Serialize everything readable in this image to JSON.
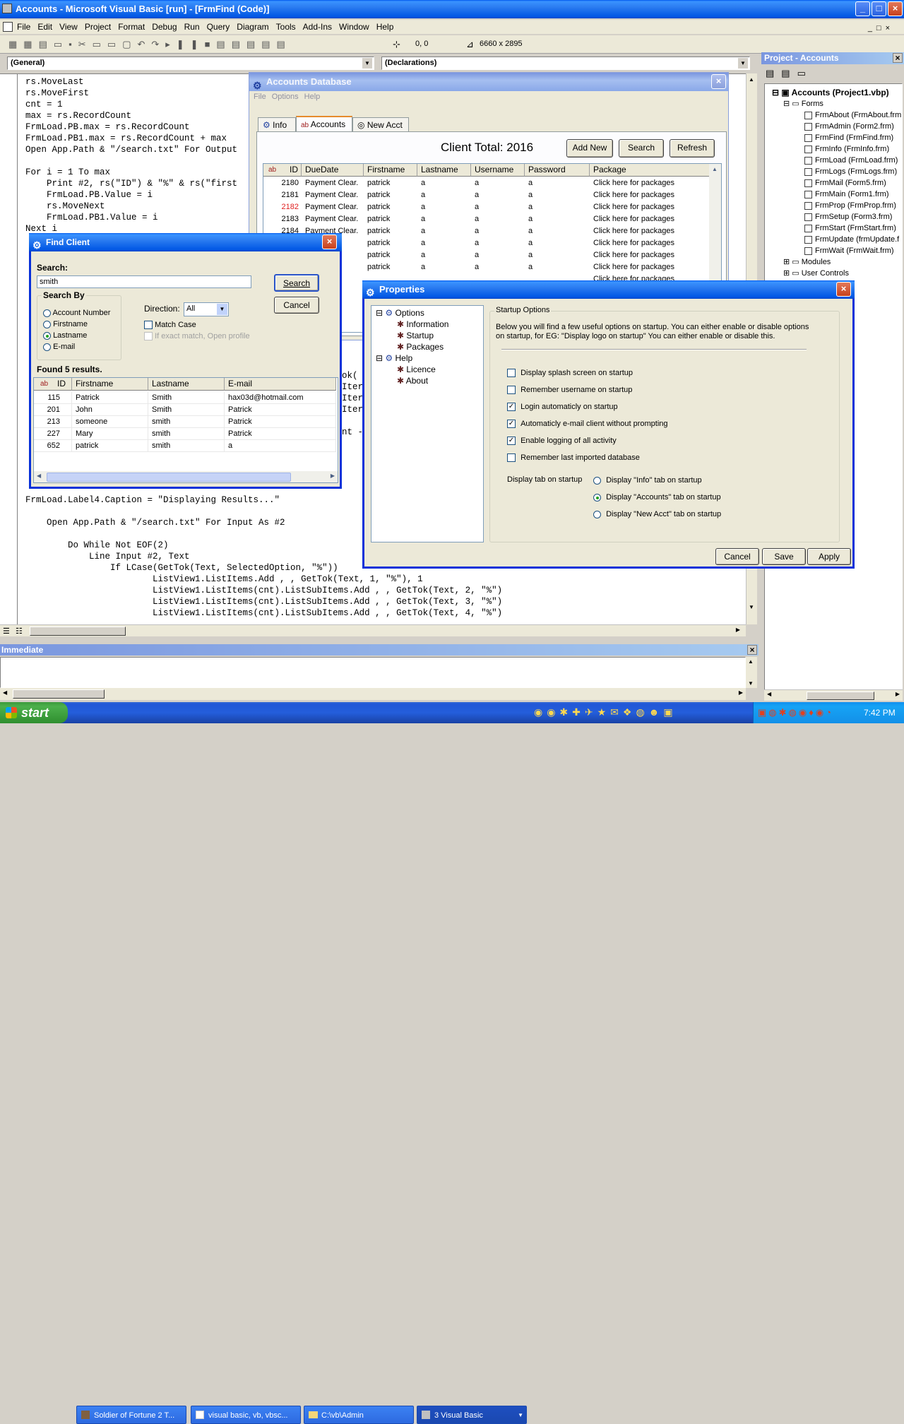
{
  "main_title": "Accounts - Microsoft Visual Basic [run] - [FrmFind (Code)]",
  "menu": [
    "File",
    "Edit",
    "View",
    "Project",
    "Format",
    "Debug",
    "Run",
    "Query",
    "Diagram",
    "Tools",
    "Add-Ins",
    "Window",
    "Help"
  ],
  "toolbar": {
    "coords": "0, 0",
    "size": "6660 x 2895"
  },
  "combo_left": "(General)",
  "combo_right": "(Declarations)",
  "code_lines": [
    "rs.MoveLast",
    "rs.MoveFirst",
    "cnt = 1",
    "max = rs.RecordCount",
    "FrmLoad.PB.max = rs.RecordCount",
    "FrmLoad.PB1.max = rs.RecordCount + max",
    "Open App.Path & \"/search.txt\" For Output",
    "",
    "For i = 1 To max",
    "    Print #2, rs(\"ID\") & \"%\" & rs(\"first",
    "    FrmLoad.PB.Value = i",
    "    rs.MoveNext",
    "    FrmLoad.PB1.Value = i",
    "Next i"
  ],
  "code_lines2": [
    "FrmLoad.Label4.Caption = \"Displaying Results...\"",
    "",
    "    Open App.Path & \"/search.txt\" For Input As #2",
    "",
    "        Do While Not EOF(2)",
    "            Line Input #2, Text",
    "                If LCase(GetTok(Text, SelectedOption, \"%\"))",
    "                        ListView1.ListItems.Add , , GetTok(Text, 1, \"%\"), 1",
    "                        ListView1.ListItems(cnt).ListSubItems.Add , , GetTok(Text, 2, \"%\")",
    "                        ListView1.ListItems(cnt).ListSubItems.Add , , GetTok(Text, 3, \"%\")",
    "                        ListView1.ListItems(cnt).ListSubItems.Add , , GetTok(Text, 4, \"%\")"
  ],
  "code_frag": [
    "ok(",
    "Iter",
    "Iter",
    "Iter",
    "",
    "nt -"
  ],
  "project": {
    "title": "Project - Accounts",
    "root": "Accounts (Project1.vbp)",
    "forms_label": "Forms",
    "forms": [
      "FrmAbout (FrmAbout.frm",
      "FrmAdmin (Form2.frm)",
      "FrmFind (FrmFind.frm)",
      "FrmInfo (FrmInfo.frm)",
      "FrmLoad (FrmLoad.frm)",
      "FrmLogs (FrmLogs.frm)",
      "FrmMail (Form5.frm)",
      "FrmMain (Form1.frm)",
      "FrmProp (FrmProp.frm)",
      "FrmSetup (Form3.frm)",
      "FrmStart (FrmStart.frm)",
      "FrmUpdate (frmUpdate.f",
      "FrmWait (FrmWait.frm)"
    ],
    "others": [
      "Modules",
      "User Controls"
    ]
  },
  "immediate": "Immediate",
  "accounts": {
    "title": "Accounts Database",
    "menu": [
      "File",
      "Options",
      "Help"
    ],
    "tabs": [
      "Info",
      "Accounts",
      "New Acct"
    ],
    "client_total": "Client Total: 2016",
    "buttons": [
      "Add New",
      "Search",
      "Refresh"
    ],
    "columns": [
      "ID",
      "DueDate",
      "Firstname",
      "Lastname",
      "Username",
      "Password",
      "Package"
    ],
    "rows": [
      [
        "2180",
        "Payment Clear.",
        "patrick",
        "a",
        "a",
        "a",
        "Click here for packages"
      ],
      [
        "2181",
        "Payment Clear.",
        "patrick",
        "a",
        "a",
        "a",
        "Click here for packages"
      ],
      [
        "2182",
        "Payment Clear.",
        "patrick",
        "a",
        "a",
        "a",
        "Click here for packages"
      ],
      [
        "2183",
        "Payment Clear.",
        "patrick",
        "a",
        "a",
        "a",
        "Click here for packages"
      ],
      [
        "2184",
        "Payment Clear.",
        "patrick",
        "a",
        "a",
        "a",
        "Click here for packages"
      ],
      [
        "",
        "lear.",
        "patrick",
        "a",
        "a",
        "a",
        "Click here for packages"
      ],
      [
        "",
        "lear.",
        "patrick",
        "a",
        "a",
        "a",
        "Click here for packages"
      ],
      [
        "",
        "lear.",
        "patrick",
        "a",
        "a",
        "a",
        "Click here for packages"
      ],
      [
        "",
        "lear.",
        "",
        "",
        "",
        "",
        "Click here for packages"
      ]
    ],
    "frag_rows": [
      "lear.",
      "lear.",
      "lear."
    ]
  },
  "find": {
    "title": "Find Client",
    "search_label": "Search:",
    "search_value": "smith",
    "search_btn": "Search",
    "cancel_btn": "Cancel",
    "group": "Search By",
    "options": [
      "Account Number",
      "Firstname",
      "Lastname",
      "E-mail"
    ],
    "direction_label": "Direction:",
    "direction_value": "All",
    "match_case": "Match Case",
    "exact": "If exact match, Open profile",
    "found": "Found 5 results.",
    "columns": [
      "ID",
      "Firstname",
      "Lastname",
      "E-mail"
    ],
    "rows": [
      [
        "115",
        "Patrick",
        "Smith",
        "hax03d@hotmail.com"
      ],
      [
        "201",
        "John",
        "Smith",
        "Patrick"
      ],
      [
        "213",
        "someone",
        "smith",
        "Patrick"
      ],
      [
        "227",
        "Mary",
        "smith",
        "Patrick"
      ],
      [
        "652",
        "patrick",
        "smith",
        "a"
      ]
    ]
  },
  "props": {
    "title": "Properties",
    "tree": {
      "options": "Options",
      "opt_items": [
        "Information",
        "Startup",
        "Packages"
      ],
      "help": "Help",
      "help_items": [
        "Licence",
        "About"
      ]
    },
    "group": "Startup Options",
    "desc": "Below you will find a few useful options on startup.  You can either enable or disable options on startup, for EG:  \"Display logo on startup\" You can either enable or disable this.",
    "checks": [
      [
        "Display splash screen on startup",
        false
      ],
      [
        "Remember username on startup",
        false
      ],
      [
        "Login automaticly on startup",
        true
      ],
      [
        "Automaticly e-mail client without prompting",
        true
      ],
      [
        "Enable logging of all activity",
        true
      ],
      [
        "Remember last imported database",
        false
      ]
    ],
    "tab_label": "Display tab on startup",
    "radios": [
      [
        "Display \"Info\" tab on startup",
        false
      ],
      [
        "Display \"Accounts\" tab on startup",
        true
      ],
      [
        "Display \"New Acct\" tab on startup",
        false
      ]
    ],
    "buttons": [
      "Cancel",
      "Save",
      "Apply"
    ]
  },
  "taskbar": {
    "start": "start",
    "items": [
      "Soldier of Fortune 2 T...",
      "visual basic, vb, vbsc...",
      "C:\\vb\\Admin",
      "3 Visual Basic"
    ],
    "clock": "7:42 PM"
  }
}
